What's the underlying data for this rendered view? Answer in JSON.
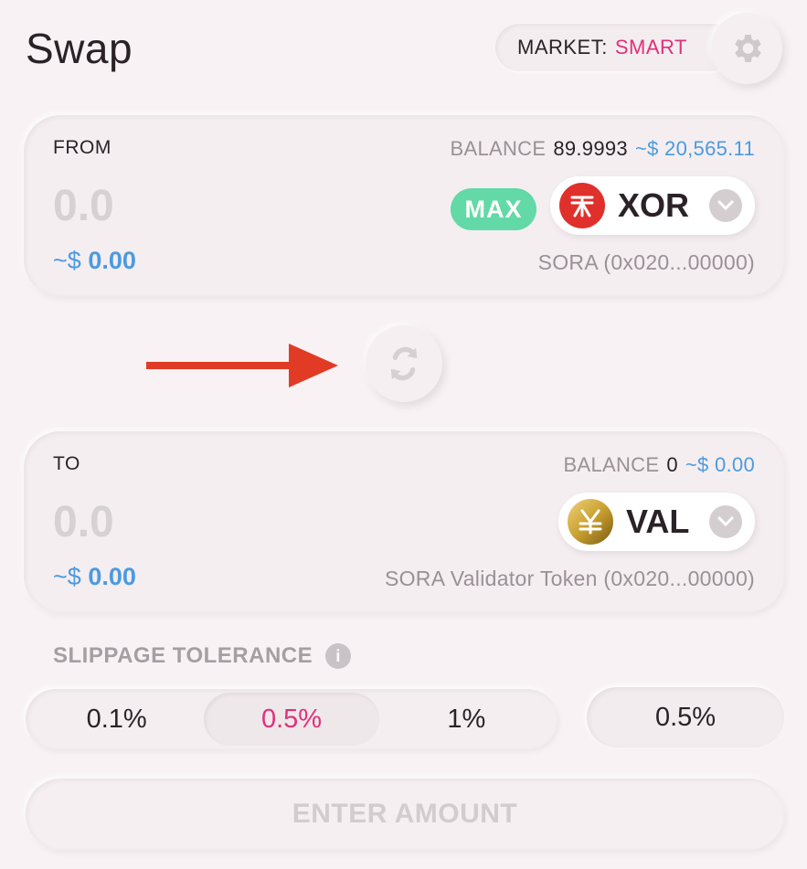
{
  "header": {
    "title": "Swap",
    "market_label": "MARKET:",
    "market_value": "SMART",
    "settings_icon": "gear-icon"
  },
  "from": {
    "label": "FROM",
    "balance_label": "BALANCE",
    "balance_value": "89.9993",
    "balance_usd": "~$ 20,565.11",
    "amount": "0.0",
    "usd_tilde": "~$",
    "usd_value": "0.00",
    "max_label": "MAX",
    "token_symbol": "XOR",
    "token_name": "SORA (0x020...00000)"
  },
  "swap": {
    "icon": "swap-arrows-icon",
    "annotation": "red-arrow"
  },
  "to": {
    "label": "TO",
    "balance_label": "BALANCE",
    "balance_value": "0",
    "balance_usd": "~$ 0.00",
    "amount": "0.0",
    "usd_tilde": "~$",
    "usd_value": "0.00",
    "token_symbol": "VAL",
    "token_name": "SORA Validator Token (0x020...00000)"
  },
  "slippage": {
    "title": "SLIPPAGE TOLERANCE",
    "options": [
      "0.1%",
      "0.5%",
      "1%"
    ],
    "selected": "0.5%",
    "custom_value": "0.5%"
  },
  "action": {
    "label": "ENTER AMOUNT"
  },
  "colors": {
    "accent_pink": "#e0307a",
    "usd_blue": "#4c9ae0",
    "max_green": "#62d9a6",
    "xor_red": "#e0302c",
    "val_gold": "#c9a030",
    "arrow_red": "#e23b25"
  }
}
